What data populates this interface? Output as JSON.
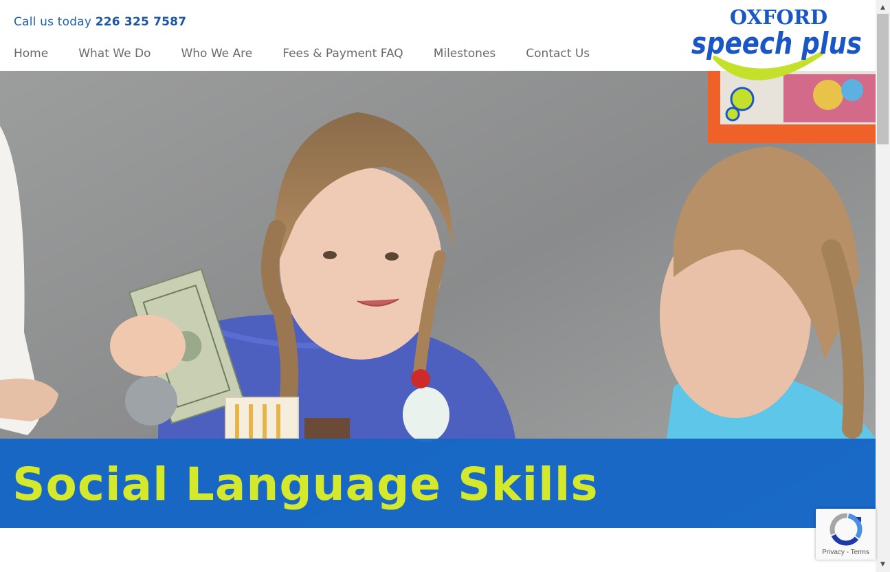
{
  "header": {
    "call_prefix": "Call us today",
    "phone_number": "226 325 7587",
    "nav": [
      {
        "label": "Home"
      },
      {
        "label": "What We Do"
      },
      {
        "label": "Who We Are"
      },
      {
        "label": "Fees & Payment FAQ"
      },
      {
        "label": "Milestones"
      },
      {
        "label": "Contact Us"
      }
    ]
  },
  "logo": {
    "line1": "OXFORD",
    "line2": "speech plus",
    "colors": {
      "blue": "#1a56c4",
      "green": "#c5e02a"
    }
  },
  "hero": {
    "title": "Social Language Skills",
    "banner_color": "#0f64c8",
    "title_color": "#d4e82c"
  },
  "recaptcha": {
    "privacy_label": "Privacy",
    "separator": " - ",
    "terms_label": "Terms"
  },
  "icons": [
    "recaptcha-icon",
    "scroll-up-arrow-icon",
    "scroll-down-arrow-icon"
  ]
}
